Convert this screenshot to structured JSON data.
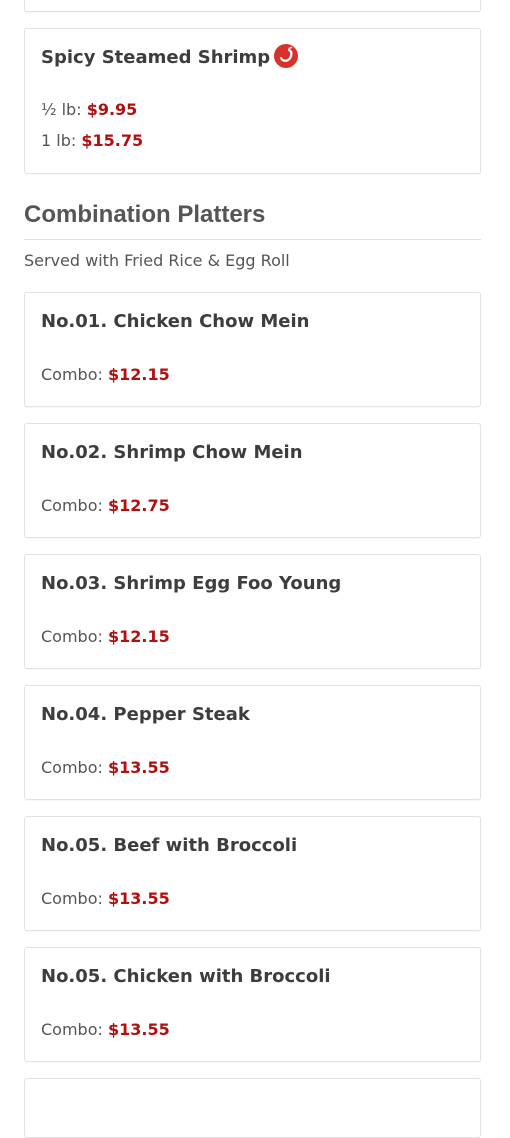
{
  "spicy_item": {
    "title": "Spicy Steamed Shrimp",
    "icon": "hot-pepper-icon",
    "prices": [
      {
        "label": "½ lb:",
        "price": "$9.95"
      },
      {
        "label": "1 lb:",
        "price": "$15.75"
      }
    ]
  },
  "section": {
    "title": "Combination Platters",
    "subtitle": "Served with Fried Rice & Egg Roll"
  },
  "combos": [
    {
      "title": "No.01. Chicken Chow Mein",
      "label": "Combo:",
      "price": "$12.15"
    },
    {
      "title": "No.02. Shrimp Chow Mein",
      "label": "Combo:",
      "price": "$12.75"
    },
    {
      "title": "No.03. Shrimp Egg Foo Young",
      "label": "Combo:",
      "price": "$12.15"
    },
    {
      "title": "No.04. Pepper Steak",
      "label": "Combo:",
      "price": "$13.55"
    },
    {
      "title": "No.05. Beef with Broccoli",
      "label": "Combo:",
      "price": "$13.55"
    },
    {
      "title": "No.05. Chicken with Broccoli",
      "label": "Combo:",
      "price": "$13.55"
    }
  ],
  "colors": {
    "price": "#b30f0f",
    "spicy_icon": "#d9322b",
    "border": "#e2e2e2"
  }
}
